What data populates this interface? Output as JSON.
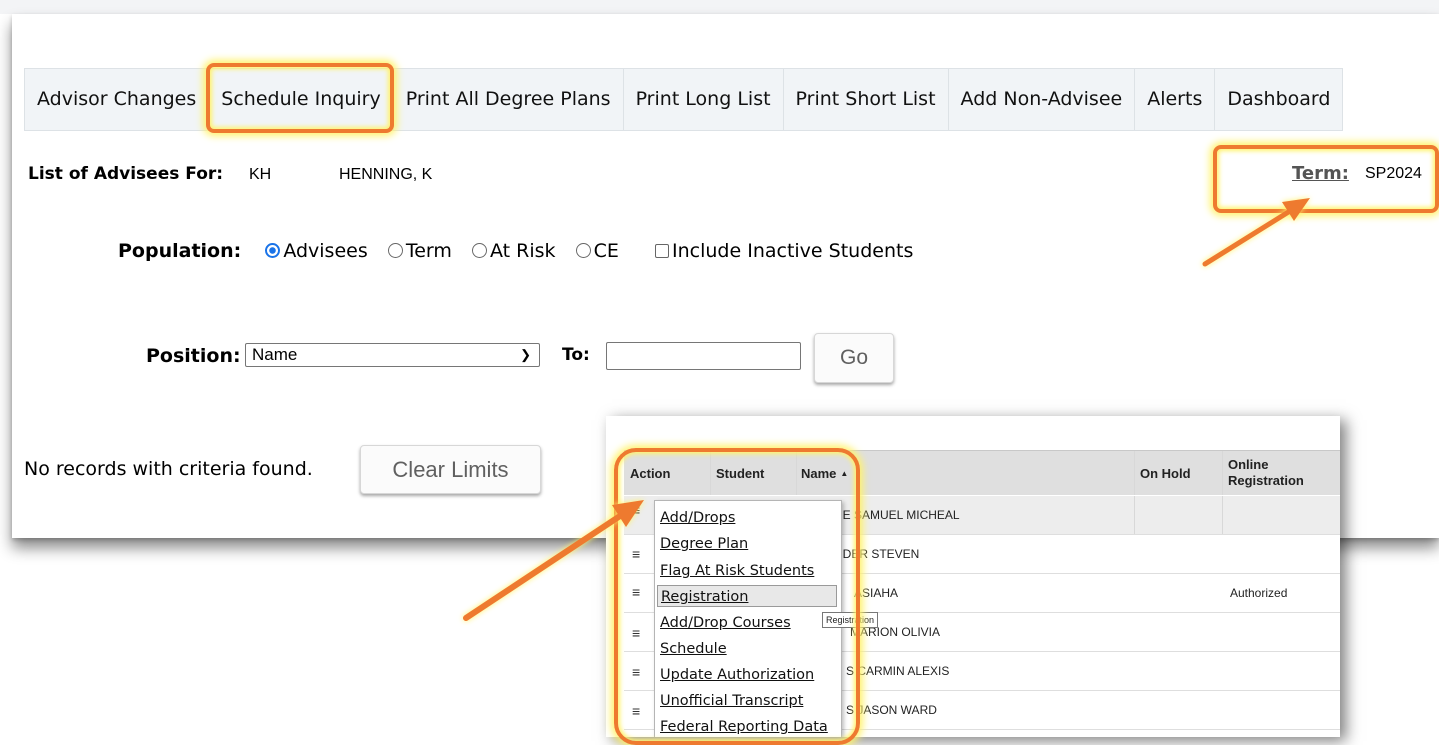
{
  "tabs": [
    {
      "label": "Advisor Changes"
    },
    {
      "label": "Schedule Inquiry"
    },
    {
      "label": "Print All Degree Plans"
    },
    {
      "label": "Print Long List"
    },
    {
      "label": "Print Short List"
    },
    {
      "label": "Add Non-Advisee"
    },
    {
      "label": "Alerts"
    },
    {
      "label": "Dashboard"
    }
  ],
  "advisee_header": {
    "label": "List of Advisees For:",
    "advisor_code": "KH",
    "advisor_name": "HENNING, K"
  },
  "term": {
    "label": "Term:",
    "value": "SP2024"
  },
  "population": {
    "label": "Population:",
    "options": [
      {
        "label": "Advisees",
        "checked": true
      },
      {
        "label": "Term",
        "checked": false
      },
      {
        "label": "At Risk",
        "checked": false
      },
      {
        "label": "CE",
        "checked": false
      }
    ],
    "include_inactive_label": "Include Inactive Students"
  },
  "position": {
    "label": "Position:",
    "selected": "Name",
    "to_label": "To:",
    "to_value": "",
    "go_label": "Go"
  },
  "no_records": "No records with criteria found.",
  "clear_limits_label": "Clear Limits",
  "grid": {
    "headers": {
      "action": "Action",
      "student": "Student",
      "name": "Name",
      "sort_arrow": "▲",
      "on_hold": "On Hold",
      "online_reg": "Online Registration"
    },
    "rows": [
      {
        "name": "NE SAMUEL MICHEAL",
        "online": ""
      },
      {
        "name": "NDER STEVEN",
        "online": ""
      },
      {
        "name": "ASIAHA",
        "online": "Authorized"
      },
      {
        "name": "MARION OLIVIA",
        "online": ""
      },
      {
        "name": "S CARMIN ALEXIS",
        "online": ""
      },
      {
        "name": "S JASON WARD",
        "online": ""
      }
    ]
  },
  "context_menu": {
    "items": [
      {
        "label": "Add/Drops"
      },
      {
        "label": "Degree Plan"
      },
      {
        "label": "Flag At Risk Students"
      },
      {
        "label": "Registration"
      },
      {
        "label": "Add/Drop Courses"
      },
      {
        "label": "Schedule"
      },
      {
        "label": "Update Authorization"
      },
      {
        "label": "Unofficial Transcript"
      },
      {
        "label": "Federal Reporting Data"
      }
    ],
    "tooltip": "Registration"
  },
  "colors": {
    "highlight": "#ee7a2f",
    "glow": "#fff26a",
    "radio": "#1a73e8"
  },
  "icons": {
    "row_menu": "hamburger-menu-icon"
  }
}
